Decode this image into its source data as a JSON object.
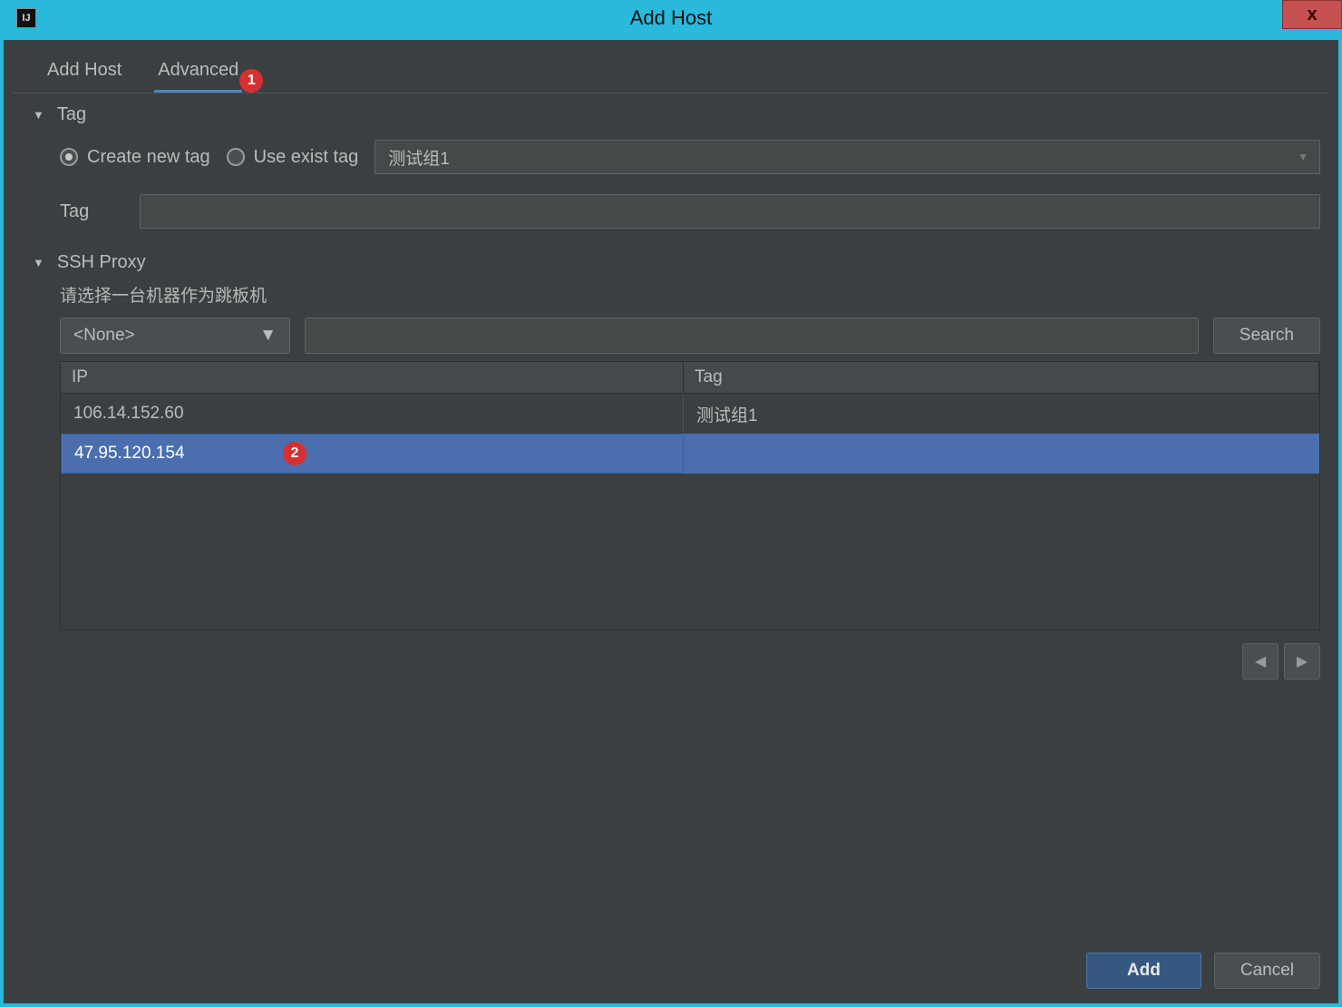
{
  "window": {
    "title": "Add Host",
    "close": "x",
    "icon_text": "IJ"
  },
  "tabs": {
    "add_host": "Add Host",
    "advanced": "Advanced"
  },
  "annotations": {
    "a1": "1",
    "a2": "2"
  },
  "tag_section": {
    "header": "Tag",
    "create_new": "Create new tag",
    "use_exist": "Use exist tag",
    "combo_value": "测试组1",
    "field_label": "Tag",
    "field_value": ""
  },
  "ssh_section": {
    "header": "SSH Proxy",
    "hint": "请选择一台机器作为跳板机",
    "filter_value": "<None>",
    "search_value": "",
    "search_btn": "Search",
    "columns": {
      "ip": "IP",
      "tag": "Tag"
    },
    "rows": [
      {
        "ip": "106.14.152.60",
        "tag": "测试组1",
        "selected": false
      },
      {
        "ip": "47.95.120.154",
        "tag": "",
        "selected": true
      }
    ]
  },
  "footer": {
    "add": "Add",
    "cancel": "Cancel"
  }
}
